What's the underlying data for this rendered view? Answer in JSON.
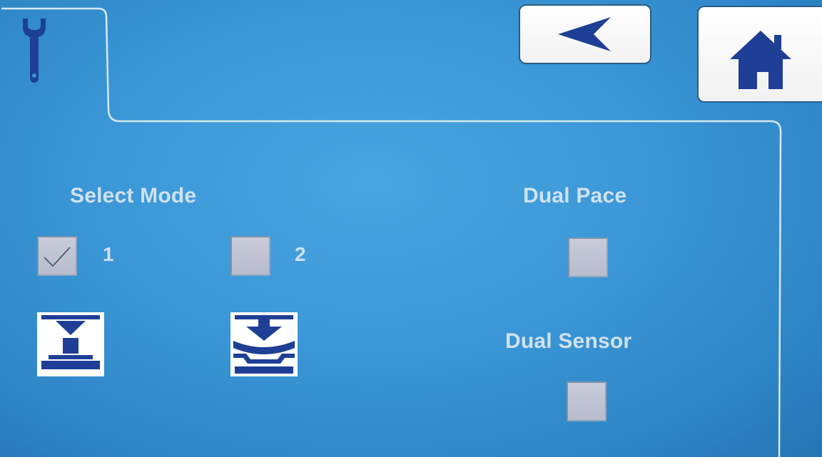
{
  "header": {
    "active_tab_icon": "wrench-icon",
    "back_button_icon": "back-arrow-icon",
    "home_button_icon": "home-icon"
  },
  "select_mode": {
    "title": "Select Mode",
    "options": [
      {
        "label": "1",
        "checked": true,
        "icon": "press-single-mode-icon"
      },
      {
        "label": "2",
        "checked": false,
        "icon": "press-bending-mode-icon"
      }
    ]
  },
  "dual_pace": {
    "title": "Dual Pace",
    "checked": false
  },
  "dual_sensor": {
    "title": "Dual Sensor",
    "checked": false
  },
  "colors": {
    "background": "#3a96d6",
    "label_text": "#cfe1f0",
    "icon_navy": "#1e3f95",
    "checkbox_fill": "#c4c6d6",
    "button_fill": "#ffffff"
  }
}
